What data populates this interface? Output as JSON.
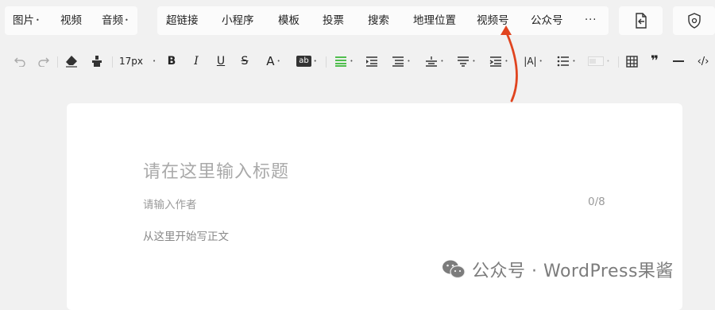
{
  "menu": {
    "media": [
      {
        "label": "图片",
        "has_caret": true
      },
      {
        "label": "视频",
        "has_caret": false
      },
      {
        "label": "音频",
        "has_caret": true
      }
    ],
    "insert": [
      "超链接",
      "小程序",
      "模板",
      "投票",
      "搜索",
      "地理位置",
      "视频号",
      "公众号"
    ],
    "more": "···"
  },
  "toolbar": {
    "font_size": "17px",
    "bold": "B",
    "italic": "I",
    "underline": "U",
    "strike": "S",
    "font_color": "A",
    "bg_color": "ab",
    "letter_spacing": "|A|",
    "quote": "❞",
    "code": "‹/›"
  },
  "editor": {
    "title_placeholder": "请在这里输入标题",
    "author_placeholder": "请输入作者",
    "author_count": "0/8",
    "body_placeholder": "从这里开始写正文"
  },
  "watermark": {
    "text": "公众号 · WordPress果酱"
  },
  "colors": {
    "accent_green": "#1aad19",
    "arrow_red": "#e0441f",
    "bar_bg": "#f1f1f1",
    "editor_bg": "#ffffff"
  }
}
